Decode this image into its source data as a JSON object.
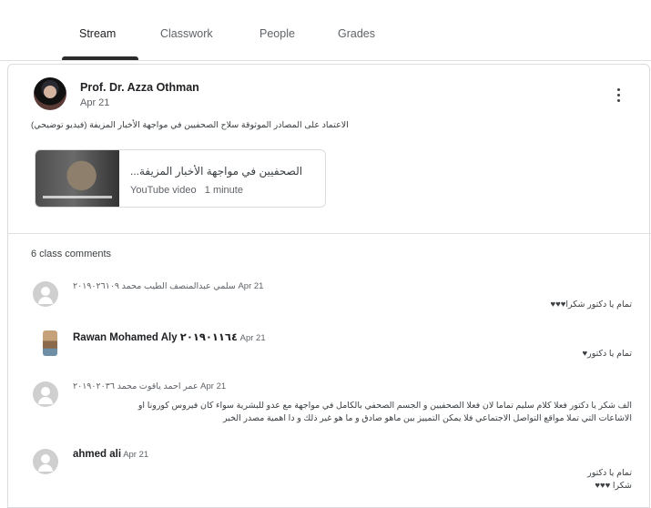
{
  "tabs": [
    {
      "label": "Stream"
    },
    {
      "label": "Classwork"
    },
    {
      "label": "People"
    },
    {
      "label": "Grades"
    }
  ],
  "post": {
    "author": "Prof. Dr. Azza Othman",
    "date": "Apr 21",
    "text": "الاعتماد على المصادر الموثوقة سلاح الصحفيين في مواجهة الأخبار المزيفة (فيديو توضيحي)",
    "attachment": {
      "title": "الصحفيين في مواجهة الأخبار المزيفة...",
      "type_label": "YouTube video",
      "duration": "1 minute"
    }
  },
  "comments_section": {
    "count_label": "6 class comments",
    "comments": [
      {
        "name": "سلمي عبدالمنصف الطيب محمد ٢٠١٩٠٢٦١٠٩",
        "date": "Apr 21",
        "lines": [
          "تمام يا دكتور شكرا♥♥♥"
        ]
      },
      {
        "name": "Rawan Mohamed Aly ٢٠١٩٠١١٦٤",
        "date": "Apr 21",
        "lines": [
          "تمام يا دكتور♥"
        ]
      },
      {
        "name": "عمر احمد ياقوت محمد ٢٠١٩٠٢٠٣٦",
        "date": "Apr 21",
        "lines": [
          "الف شكر يا دكتور فعلا كلام سليم تماما لان فعلا الصحفيين و الجسم الصحفي بالكامل في مواجهة مع عدو للبشرية سواء كان فيروس كورونا او",
          "الاشاعات التي تملا مواقع التواصل الاجتماعي فلا يمكن التمييز بين ماهو صادق و ما هو غير ذلك و دا اهمية مصدر الخبر"
        ]
      },
      {
        "name": "ahmed ali",
        "date": "Apr 21",
        "lines": [
          "تمام يا دكتور",
          "شكرا ♥♥♥"
        ]
      }
    ]
  }
}
